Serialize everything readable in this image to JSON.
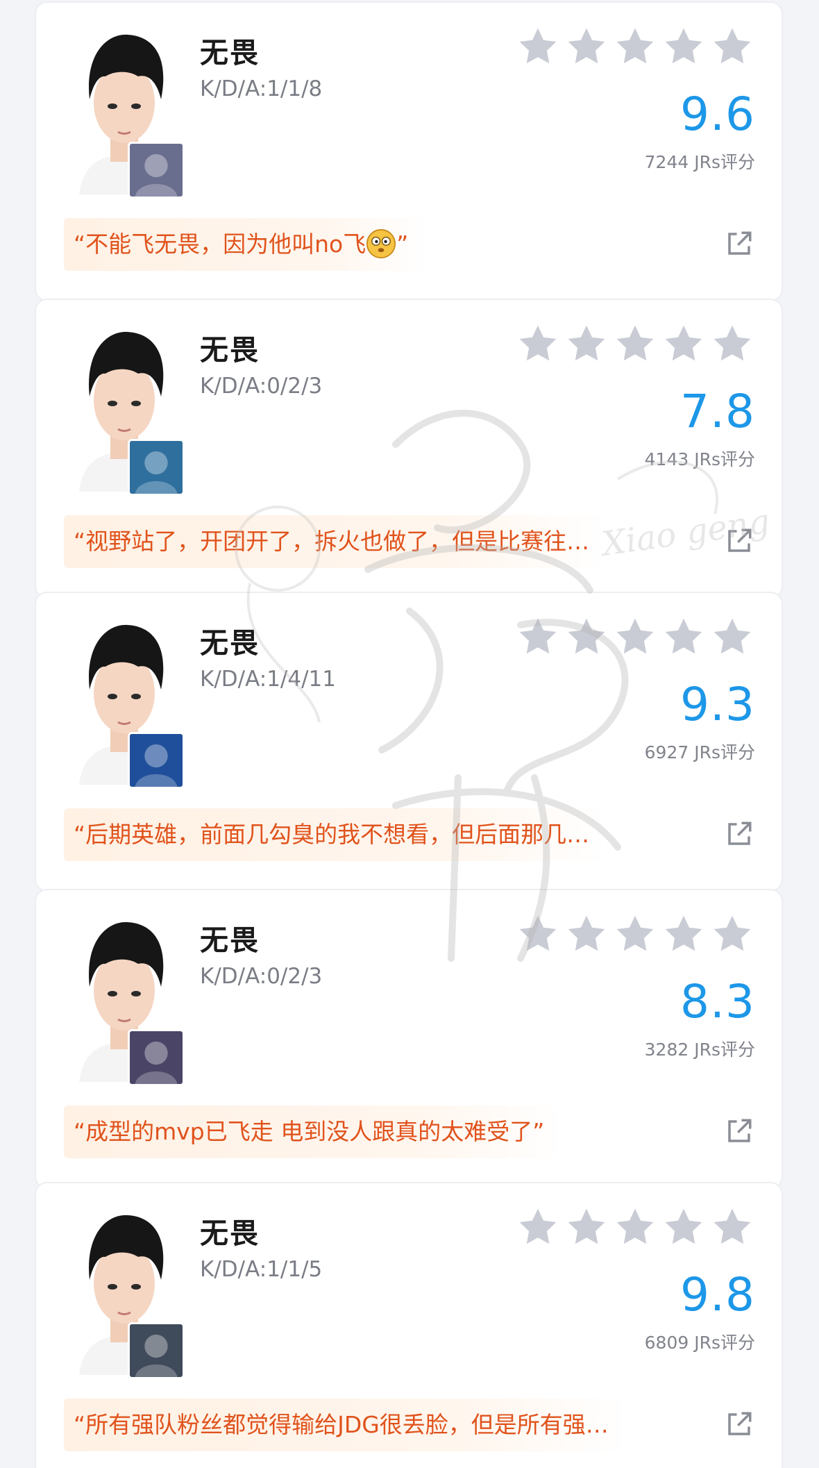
{
  "cards": [
    {
      "name": "无畏",
      "kda": "K/D/A:1/1/8",
      "score": "9.6",
      "rating_count": "7244 JRs评分",
      "comment": "“不能飞无畏，因为他叫no飞",
      "comment_tail": "”",
      "hero_color": "#6a6e8e",
      "stars_filled": 0
    },
    {
      "name": "无畏",
      "kda": "K/D/A:0/2/3",
      "score": "7.8",
      "rating_count": "4143 JRs评分",
      "comment": "“视野站了，开团开了，拆火也做了，但是比赛往…",
      "hero_color": "#2f6f9e",
      "stars_filled": 0
    },
    {
      "name": "无畏",
      "kda": "K/D/A:1/4/11",
      "score": "9.3",
      "rating_count": "6927 JRs评分",
      "comment": "“后期英雄，前面几勾臭的我不想看，但后面那几…",
      "hero_color": "#1f4f9a",
      "stars_filled": 0
    },
    {
      "name": "无畏",
      "kda": "K/D/A:0/2/3",
      "score": "8.3",
      "rating_count": "3282 JRs评分",
      "comment": "“成型的mvp已飞走 电到没人跟真的太难受了”",
      "hero_color": "#4a4466",
      "stars_filled": 0
    },
    {
      "name": "无畏",
      "kda": "K/D/A:1/1/5",
      "score": "9.8",
      "rating_count": "6809 JRs评分",
      "comment": "“所有强队粉丝都觉得输给JDG很丢脸，但是所有强…",
      "hero_color": "#3f4a5a",
      "stars_filled": 0
    }
  ],
  "colors": {
    "score": "#1d97e8",
    "comment": "#e0531c",
    "star_empty": "#c9ccd4"
  }
}
